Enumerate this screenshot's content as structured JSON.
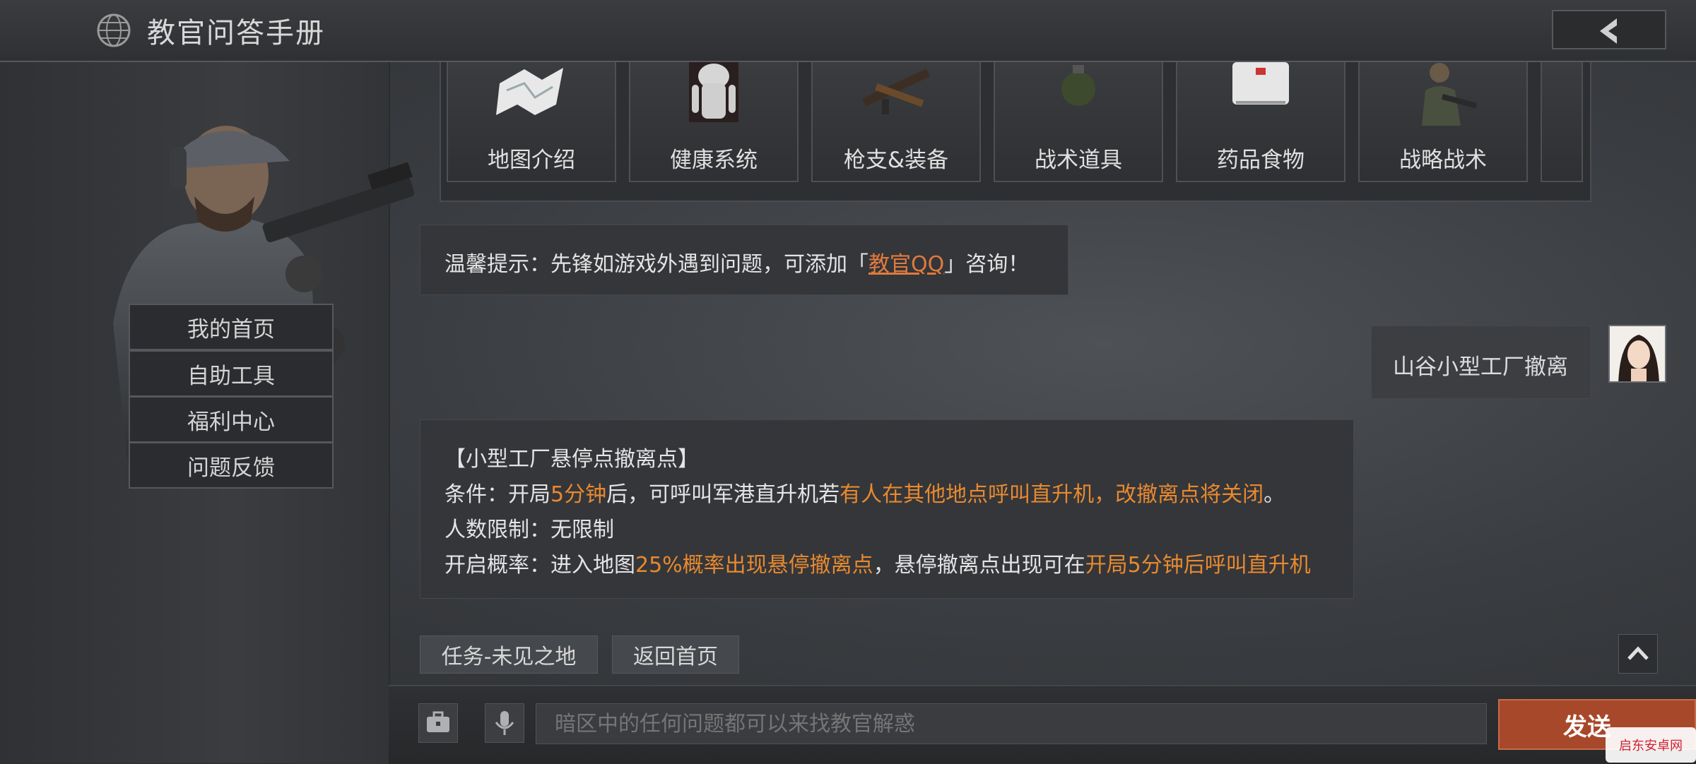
{
  "header": {
    "title": "教官问答手册"
  },
  "sidebar": {
    "items": [
      {
        "label": "我的首页"
      },
      {
        "label": "自助工具"
      },
      {
        "label": "福利中心"
      },
      {
        "label": "问题反馈"
      }
    ]
  },
  "categories": [
    {
      "label": "地图介绍",
      "icon": "map-icon"
    },
    {
      "label": "健康系统",
      "icon": "body-icon"
    },
    {
      "label": "枪支&装备",
      "icon": "rifle-icon"
    },
    {
      "label": "战术道具",
      "icon": "grenade-icon"
    },
    {
      "label": "药品食物",
      "icon": "medkit-icon"
    },
    {
      "label": "战略战术",
      "icon": "soldier-icon"
    }
  ],
  "chat": {
    "tip": {
      "prefix": "温馨提示：先锋如游戏外遇到问题，可添加「",
      "link": "教官QQ",
      "suffix": "」咨询！"
    },
    "user_message": "山谷小型工厂撤离",
    "answer": {
      "title": "【小型工厂悬停点撤离点】",
      "condition_label": "条件：开局",
      "condition_time": "5分钟",
      "condition_mid": "后，可呼叫军港直升机若",
      "condition_highlight": "有人在其他地点呼叫直升机，改撤离点将关闭",
      "condition_end": "。",
      "limit": "人数限制：无限制",
      "prob_label": "开启概率：进入地图",
      "prob_highlight": "25%概率出现悬停撤离点",
      "prob_mid": "，悬停撤离点出现可在",
      "prob_highlight2": "开局5分钟后呼叫直升机"
    }
  },
  "quick_buttons": [
    {
      "label": "任务-未见之地"
    },
    {
      "label": "返回首页"
    }
  ],
  "input": {
    "placeholder": "暗区中的任何问题都可以来找教官解惑"
  },
  "send_label": "发送",
  "watermark": "启东安卓网",
  "colors": {
    "accent": "#e8892f",
    "link": "#e07a3c",
    "send": "#a8482a"
  }
}
